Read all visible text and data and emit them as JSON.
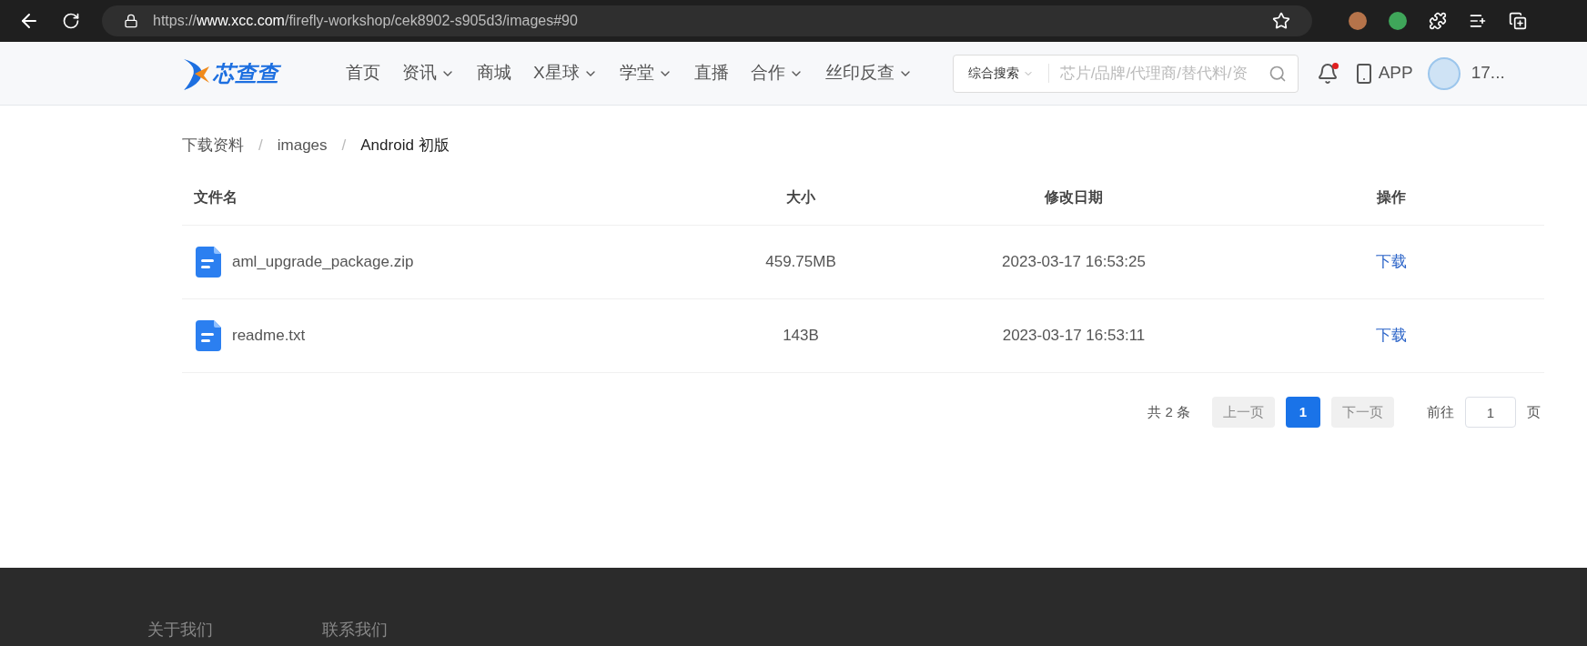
{
  "browser": {
    "url_prefix": "https://",
    "url_domain": "www.xcc.com",
    "url_path": "/firefly-workshop/cek8902-s905d3/images#90"
  },
  "header": {
    "logo": "芯查查",
    "nav": [
      {
        "label": "首页",
        "dropdown": false
      },
      {
        "label": "资讯",
        "dropdown": true
      },
      {
        "label": "商城",
        "dropdown": false
      },
      {
        "label": "X星球",
        "dropdown": true
      },
      {
        "label": "学堂",
        "dropdown": true
      },
      {
        "label": "直播",
        "dropdown": false
      },
      {
        "label": "合作",
        "dropdown": true
      },
      {
        "label": "丝印反查",
        "dropdown": true
      }
    ],
    "search": {
      "scope": "综合搜索",
      "placeholder": "芯片/品牌/代理商/替代料/资"
    },
    "notification_dot": true,
    "app": "APP",
    "user": "17..."
  },
  "breadcrumb_separator": "/",
  "breadcrumb": [
    {
      "label": "下载资料",
      "current": false
    },
    {
      "label": "images",
      "current": false
    },
    {
      "label": "Android 初版",
      "current": true
    }
  ],
  "table": {
    "columns": [
      "文件名",
      "大小",
      "修改日期",
      "操作"
    ],
    "rows": [
      {
        "name": "aml_upgrade_package.zip",
        "size": "459.75MB",
        "modified": "2023-03-17 16:53:25",
        "action": "下载"
      },
      {
        "name": "readme.txt",
        "size": "143B",
        "modified": "2023-03-17 16:53:11",
        "action": "下载"
      }
    ]
  },
  "pagination": {
    "total": "共 2 条",
    "prev": {
      "label": "上一页",
      "disabled": true
    },
    "pages": [
      {
        "label": "1",
        "selected": true
      }
    ],
    "next": {
      "label": "下一页",
      "disabled": true
    },
    "goto_label": "前往",
    "goto_value": "1",
    "goto_suffix": "页"
  },
  "footer": {
    "links": [
      "关于我们",
      "联系我们"
    ]
  }
}
